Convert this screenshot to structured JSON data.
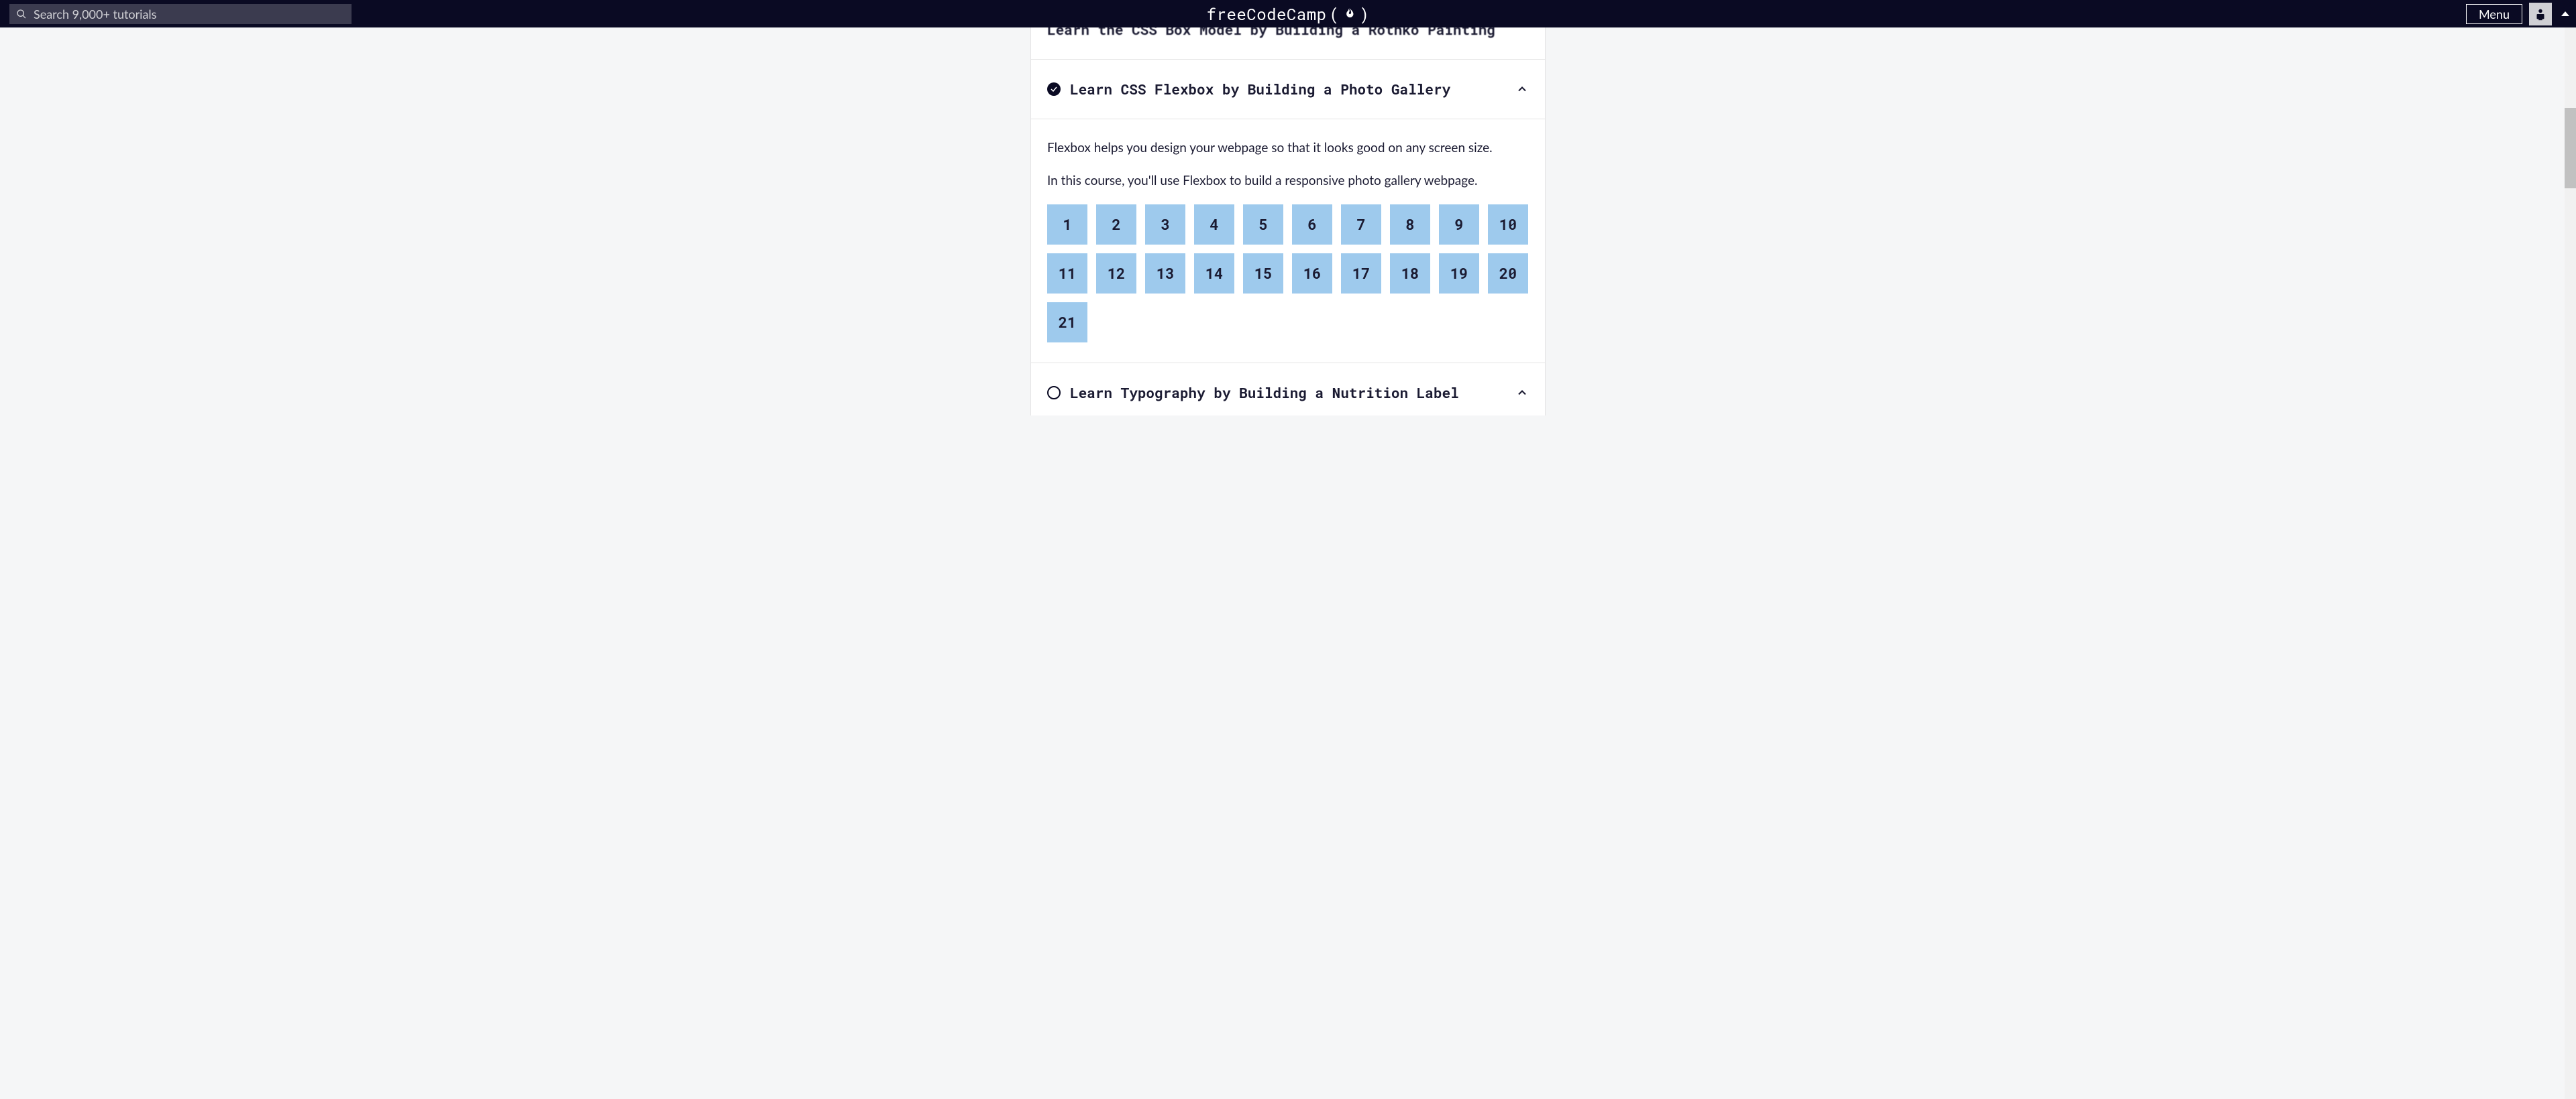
{
  "nav": {
    "search_placeholder": "Search 9,000+ tutorials",
    "brand": "freeCodeCamp",
    "menu_label": "Menu"
  },
  "peek_section_title": "Learn the CSS Box Model by Building a Rothko Painting",
  "flexbox": {
    "title": "Learn CSS Flexbox by Building a Photo Gallery",
    "para1": "Flexbox helps you design your webpage so that it looks good on any screen size.",
    "para2": "In this course, you'll use Flexbox to build a responsive photo gallery webpage.",
    "steps": [
      "1",
      "2",
      "3",
      "4",
      "5",
      "6",
      "7",
      "8",
      "9",
      "10",
      "11",
      "12",
      "13",
      "14",
      "15",
      "16",
      "17",
      "18",
      "19",
      "20",
      "21"
    ]
  },
  "typography": {
    "title": "Learn Typography by Building a Nutrition Label"
  }
}
